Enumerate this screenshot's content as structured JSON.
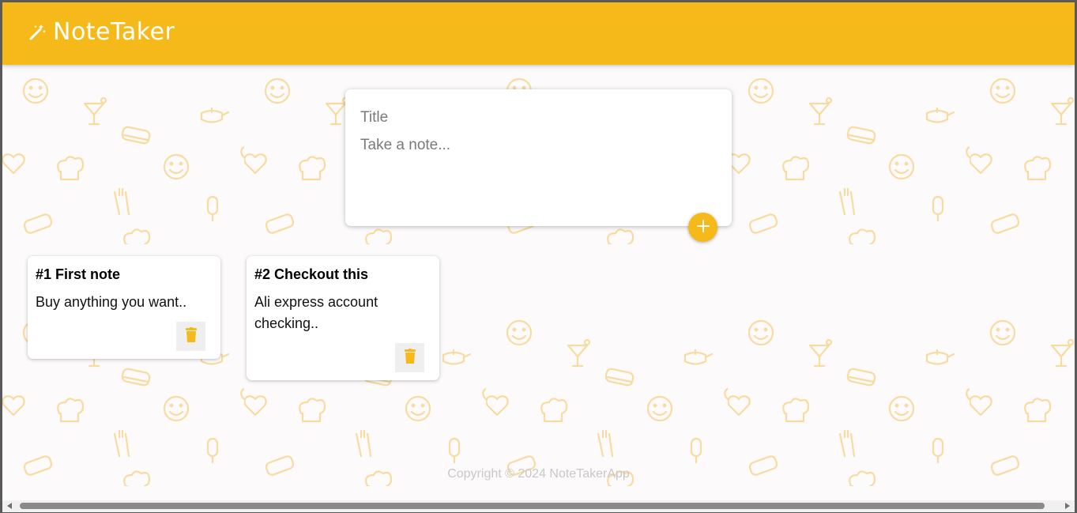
{
  "app": {
    "title": "NoteTaker",
    "accent_color": "#f5ba19"
  },
  "composer": {
    "title_placeholder": "Title",
    "body_placeholder": "Take a note..."
  },
  "notes": [
    {
      "title": "#1 First note",
      "body": "Buy anything you want.."
    },
    {
      "title": "#2 Checkout this",
      "body": "Ali express account checking.."
    }
  ],
  "footer": {
    "copyright": "Copyright © 2024 NoteTakerApp"
  },
  "icons": {
    "logo": "magic-wand-icon",
    "add": "plus-icon",
    "delete": "trash-icon"
  }
}
